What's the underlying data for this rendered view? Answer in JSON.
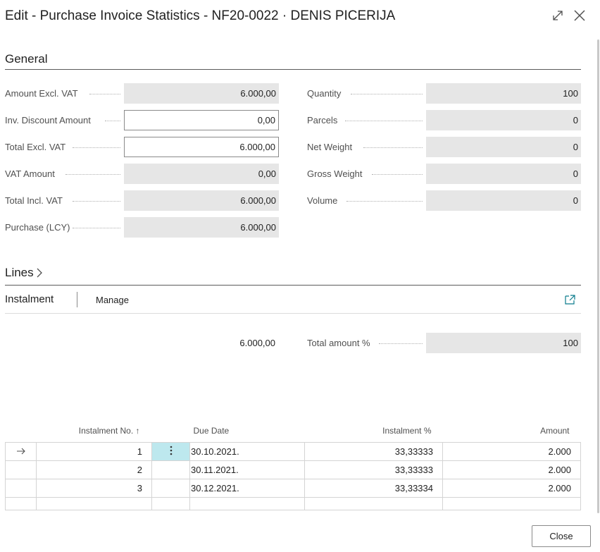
{
  "window": {
    "title": "Edit - Purchase Invoice Statistics - NF20-0022 · DENIS PICERIJA"
  },
  "general": {
    "title": "General",
    "left_fields": [
      {
        "label": "Amount Excl. VAT",
        "value": "6.000,00",
        "editable": false
      },
      {
        "label": "Inv. Discount Amount",
        "value": "0,00",
        "editable": true
      },
      {
        "label": "Total Excl. VAT",
        "value": "6.000,00",
        "editable": true
      },
      {
        "label": "VAT Amount",
        "value": "0,00",
        "editable": false
      },
      {
        "label": "Total Incl. VAT",
        "value": "6.000,00",
        "editable": false
      },
      {
        "label": "Purchase (LCY)",
        "value": "6.000,00",
        "editable": false
      }
    ],
    "right_fields": [
      {
        "label": "Quantity",
        "value": "100"
      },
      {
        "label": "Parcels",
        "value": "0"
      },
      {
        "label": "Net Weight",
        "value": "0"
      },
      {
        "label": "Gross Weight",
        "value": "0"
      },
      {
        "label": "Volume",
        "value": "0"
      }
    ]
  },
  "lines": {
    "title": "Lines",
    "tab_instalment": "Instalment",
    "tab_manage": "Manage",
    "total_amount": "6.000,00",
    "total_percent_label": "Total amount %",
    "total_percent_value": "100",
    "columns": {
      "instalment_no": "Instalment No. ↑",
      "due_date": "Due Date",
      "instalment_pct": "Instalment %",
      "amount": "Amount"
    },
    "rows": [
      {
        "no": "1",
        "due_date": "30.10.2021.",
        "pct": "33,33333",
        "amount": "2.000"
      },
      {
        "no": "2",
        "due_date": "30.11.2021.",
        "pct": "33,33333",
        "amount": "2.000"
      },
      {
        "no": "3",
        "due_date": "30.12.2021.",
        "pct": "33,33334",
        "amount": "2.000"
      }
    ]
  },
  "footer": {
    "close_label": "Close"
  },
  "icons": {
    "expand": "expand-icon",
    "close": "close-icon",
    "chevron": "chevron-right-icon",
    "open_in_new": "open-in-new-icon",
    "row_arrow": "row-arrow-icon",
    "row_menu": "row-menu-icon"
  },
  "colors": {
    "readonly_bg": "#e6e6e6",
    "active_cell": "#bde8ee",
    "accent": "#0a7b8c"
  }
}
